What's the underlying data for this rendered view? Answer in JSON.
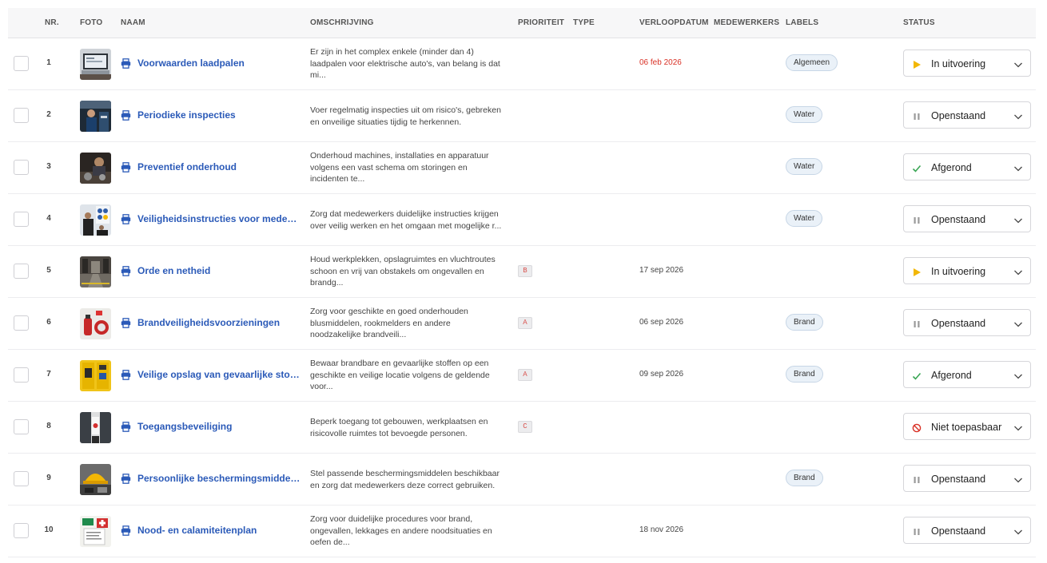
{
  "columns": {
    "nr": "NR.",
    "foto": "FOTO",
    "naam": "NAAM",
    "omschrijving": "OMSCHRIJVING",
    "prioriteit": "PRIORITEIT",
    "type": "TYPE",
    "verloopdatum": "VERLOOPDATUM",
    "medewerkers": "MEDEWERKERS",
    "labels": "LABELS",
    "status": "STATUS"
  },
  "colors": {
    "link": "#2b5ab8",
    "overdue_date": "#d93025",
    "status_in_progress": "#f2b705",
    "status_open": "#9a9a9a",
    "status_done": "#3aa655",
    "status_na": "#d93025"
  },
  "rows": [
    {
      "nr": "1",
      "naam": "Voorwaarden laadpalen",
      "desc": [
        "Er zijn in het complex enkele (minder dan 4)",
        "laadpalen voor elektrische auto's, van belang is dat",
        "mi..."
      ],
      "prioriteit": "",
      "verloopdatum": "06 feb 2026",
      "date_overdue": true,
      "label": "Algemeen",
      "status": "In uitvoering",
      "status_icon": "play-icon",
      "photo": "laptop"
    },
    {
      "nr": "2",
      "naam": "Periodieke inspecties",
      "desc": [
        "Voer regelmatig inspecties uit om risico's, gebreken",
        "en onveilige situaties tijdig te herkennen."
      ],
      "prioriteit": "",
      "verloopdatum": "",
      "date_overdue": false,
      "label": "Water",
      "status": "Openstaand",
      "status_icon": "pause-icon",
      "photo": "workshop"
    },
    {
      "nr": "3",
      "naam": "Preventief onderhoud",
      "desc": [
        "Onderhoud machines, installaties en apparatuur",
        "volgens een vast schema om storingen en",
        "incidenten te..."
      ],
      "prioriteit": "",
      "verloopdatum": "",
      "date_overdue": false,
      "label": "Water",
      "status": "Afgerond",
      "status_icon": "check-icon",
      "photo": "engine"
    },
    {
      "nr": "4",
      "naam": "Veiligheidsinstructies voor medewerkers",
      "desc": [
        "Zorg dat medewerkers duidelijke instructies krijgen",
        "over veilig werken en het omgaan met mogelijke r..."
      ],
      "prioriteit": "",
      "verloopdatum": "",
      "date_overdue": false,
      "label": "Water",
      "status": "Openstaand",
      "status_icon": "pause-icon",
      "photo": "training"
    },
    {
      "nr": "5",
      "naam": "Orde en netheid",
      "desc": [
        "Houd werkplekken, opslagruimtes en vluchtroutes",
        "schoon en vrij van obstakels om ongevallen en",
        "brandg..."
      ],
      "prioriteit": "B",
      "verloopdatum": "17 sep 2026",
      "date_overdue": false,
      "label": "",
      "status": "In uitvoering",
      "status_icon": "play-icon",
      "photo": "warehouse"
    },
    {
      "nr": "6",
      "naam": "Brandveiligheidsvoorzieningen",
      "desc": [
        "Zorg voor geschikte en goed onderhouden",
        "blusmiddelen, rookmelders en andere",
        "noodzakelijke brandveili..."
      ],
      "prioriteit": "A",
      "verloopdatum": "06 sep 2026",
      "date_overdue": false,
      "label": "Brand",
      "status": "Openstaand",
      "status_icon": "pause-icon",
      "photo": "extinguisher"
    },
    {
      "nr": "7",
      "naam": "Veilige opslag van gevaarlijke stoffen",
      "desc": [
        "Bewaar brandbare en gevaarlijke stoffen op een",
        "geschikte en veilige locatie volgens de geldende",
        "voor..."
      ],
      "prioriteit": "A",
      "verloopdatum": "09 sep 2026",
      "date_overdue": false,
      "label": "Brand",
      "status": "Afgerond",
      "status_icon": "check-icon",
      "photo": "cabinet"
    },
    {
      "nr": "8",
      "naam": "Toegangsbeveiliging",
      "desc": [
        "Beperk toegang tot gebouwen, werkplaatsen en",
        "risicovolle ruimtes tot bevoegde personen."
      ],
      "prioriteit": "C",
      "verloopdatum": "",
      "date_overdue": false,
      "label": "",
      "status": "Niet toepasbaar",
      "status_icon": "forbidden-icon",
      "photo": "door"
    },
    {
      "nr": "9",
      "naam": "Persoonlijke beschermingsmiddelen",
      "desc": [
        "Stel passende beschermingsmiddelen beschikbaar",
        "en zorg dat medewerkers deze correct gebruiken."
      ],
      "prioriteit": "",
      "verloopdatum": "",
      "date_overdue": false,
      "label": "Brand",
      "status": "Openstaand",
      "status_icon": "pause-icon",
      "photo": "helmet"
    },
    {
      "nr": "10",
      "naam": "Nood- en calamiteitenplan",
      "desc": [
        "Zorg voor duidelijke procedures voor brand,",
        "ongevallen, lekkages en andere noodsituaties en",
        "oefen de..."
      ],
      "prioriteit": "",
      "verloopdatum": "18 nov 2026",
      "date_overdue": false,
      "label": "",
      "status": "Openstaand",
      "status_icon": "pause-icon",
      "photo": "emergency"
    }
  ]
}
